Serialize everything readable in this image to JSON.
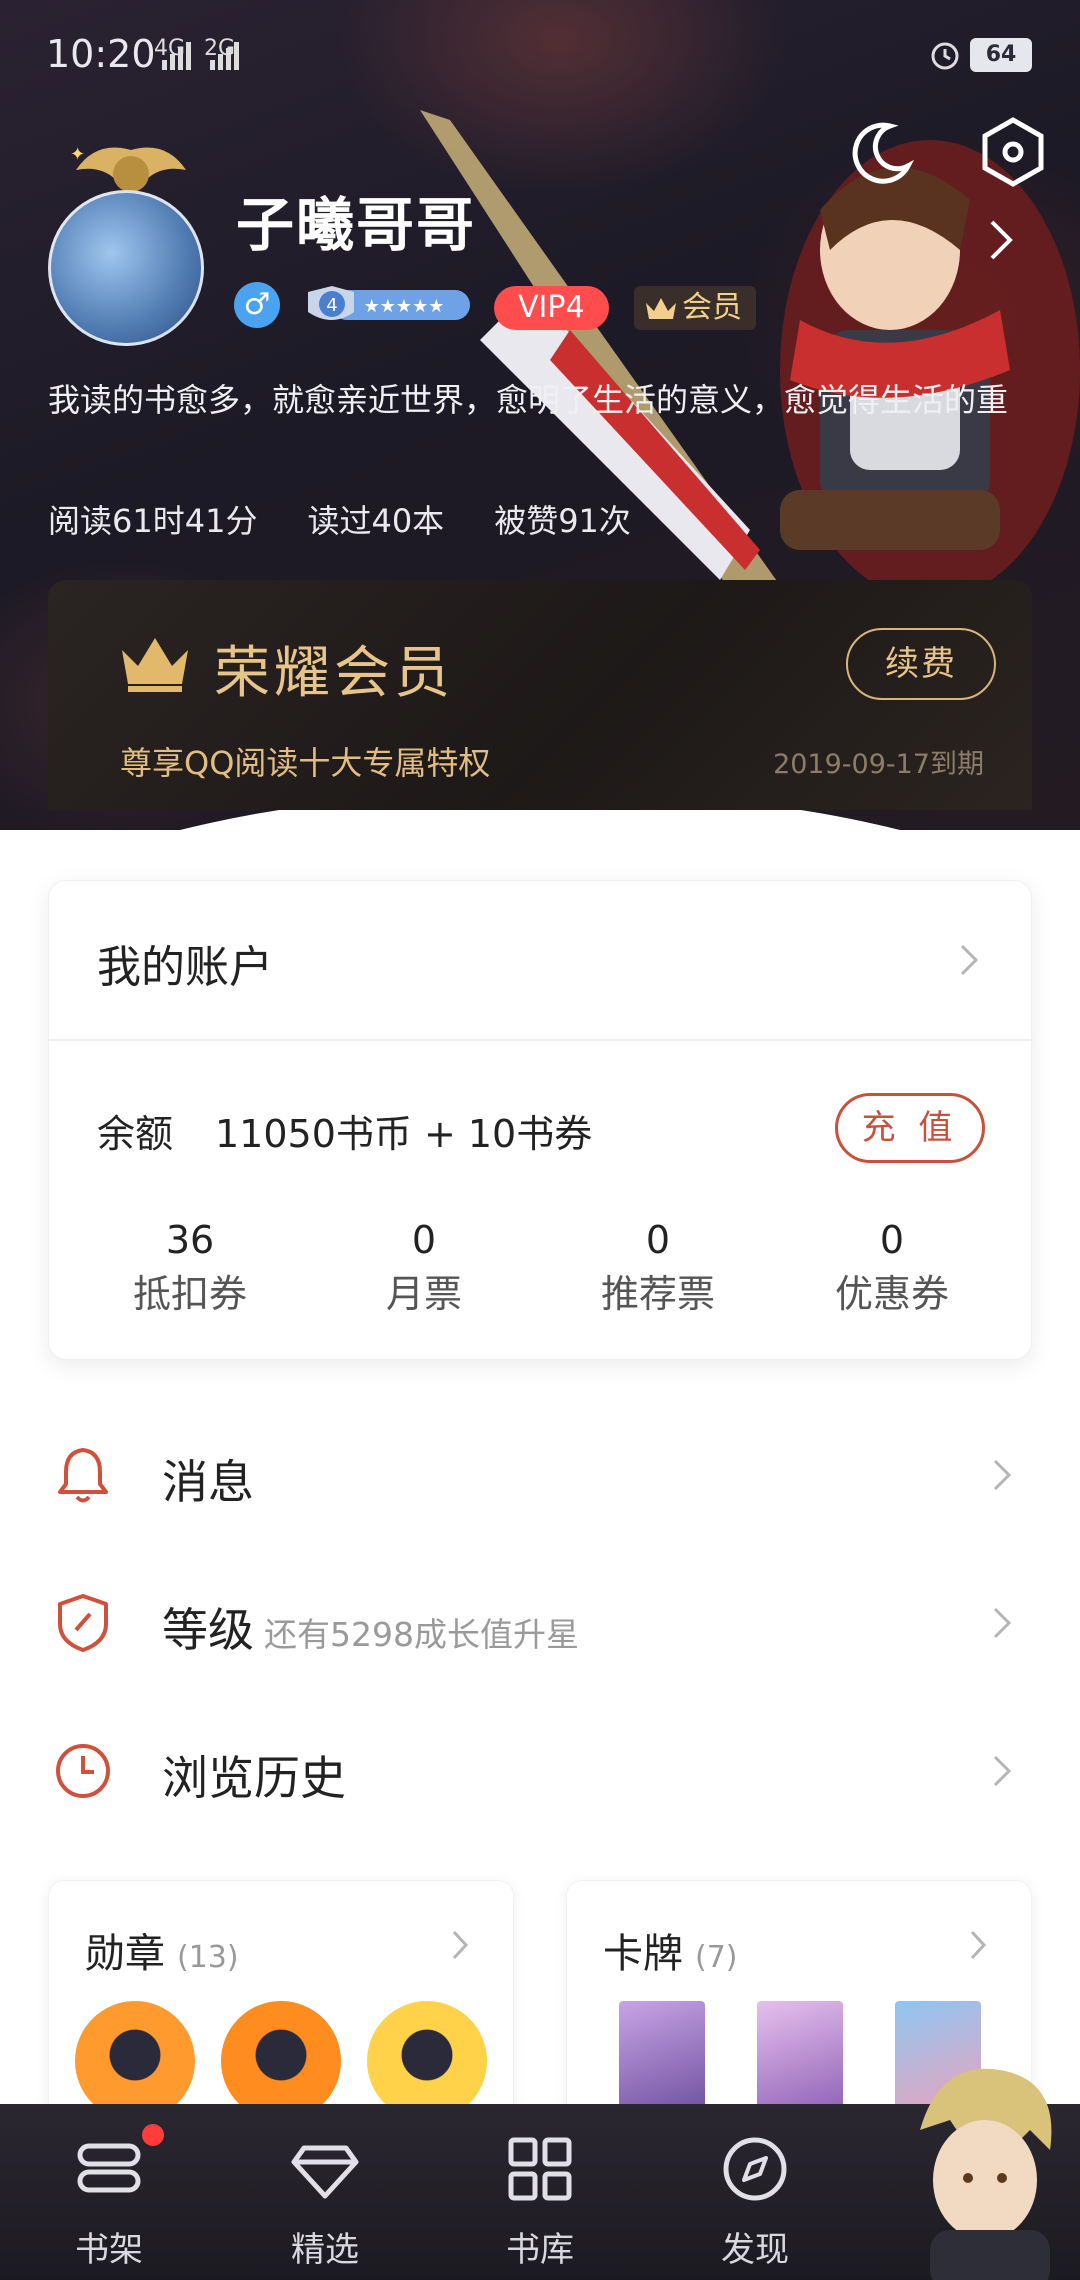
{
  "status_bar": {
    "time": "10:20",
    "network1": "4G",
    "network2": "2G",
    "battery": "64"
  },
  "profile": {
    "username": "子曦哥哥",
    "gender_symbol": "♂",
    "level": "4",
    "vip": "VIP4",
    "member_badge": "会员",
    "bio": "我读的书愈多，就愈亲近世界，愈明了生活的意义，愈觉得生活的重",
    "stats": [
      "阅读61时41分",
      "读过40本",
      "被赞91次"
    ]
  },
  "vip_card": {
    "title": "荣耀会员",
    "renew": "续费",
    "subtitle": "尊享QQ阅读十大专属特权",
    "expire": "2019-09-17到期"
  },
  "account": {
    "title": "我的账户",
    "balance_label": "余额",
    "balance_value": "11050书币 + 10书券",
    "recharge": "充 值",
    "tickets": [
      {
        "count": "36",
        "label": "抵扣券"
      },
      {
        "count": "0",
        "label": "月票"
      },
      {
        "count": "0",
        "label": "推荐票"
      },
      {
        "count": "0",
        "label": "优惠券"
      }
    ]
  },
  "menu": {
    "messages": "消息",
    "level": "等级",
    "level_sub": "还有5298成长值升星",
    "history": "浏览历史"
  },
  "cards": {
    "medals_title": "勋章",
    "medals_count": "(13)",
    "cards_title": "卡牌",
    "cards_count": "(7)"
  },
  "nav": [
    {
      "label": "书架",
      "icon": "bookshelf-icon"
    },
    {
      "label": "精选",
      "icon": "diamond-icon"
    },
    {
      "label": "书库",
      "icon": "grid-icon"
    },
    {
      "label": "发现",
      "icon": "compass-icon"
    }
  ],
  "colors": {
    "accent_red": "#c9513c",
    "gold": "#e7c48a",
    "vip_red": "#ff4d4d"
  }
}
